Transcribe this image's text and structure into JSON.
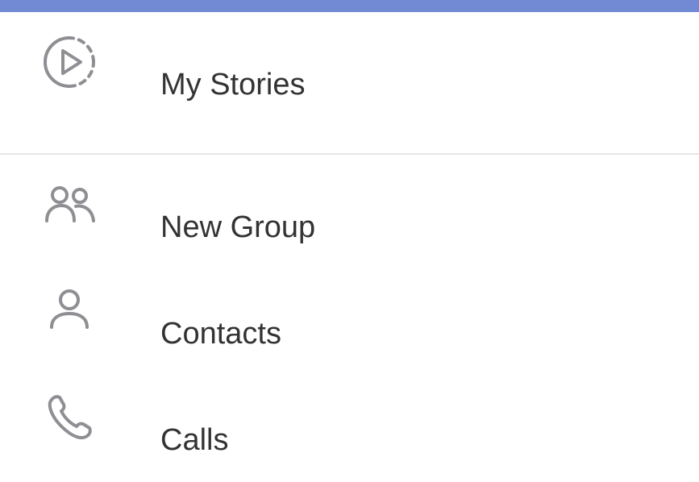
{
  "menu": {
    "items": [
      {
        "label": "My Stories",
        "icon": "stories-icon"
      },
      {
        "label": "New Group",
        "icon": "group-icon"
      },
      {
        "label": "Contacts",
        "icon": "person-icon"
      },
      {
        "label": "Calls",
        "icon": "phone-icon"
      }
    ]
  },
  "colors": {
    "accent": "#7289d4",
    "icon": "#8e8e93",
    "text": "#333333",
    "divider": "#e6e6e6"
  }
}
